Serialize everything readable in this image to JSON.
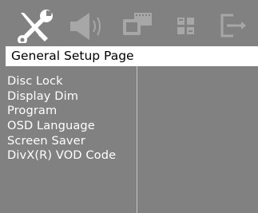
{
  "toolbar": {
    "icons": [
      {
        "name": "general-setup-icon"
      },
      {
        "name": "audio-setup-icon"
      },
      {
        "name": "video-setup-icon"
      },
      {
        "name": "preference-icon"
      },
      {
        "name": "exit-icon"
      }
    ]
  },
  "header": {
    "title": "General Setup Page"
  },
  "menu": {
    "items": [
      {
        "label": "Disc Lock"
      },
      {
        "label": "Display Dim"
      },
      {
        "label": "Program"
      },
      {
        "label": "OSD Language"
      },
      {
        "label": "Screen Saver"
      },
      {
        "label": "DivX(R) VOD Code"
      }
    ]
  },
  "colors": {
    "background": "#818181",
    "header_bg": "#ffffff",
    "icon_active": "#ffffff",
    "icon_inactive": "#a7a7a7"
  }
}
